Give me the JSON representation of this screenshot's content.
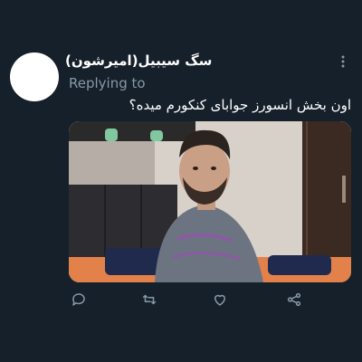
{
  "tweet": {
    "author_name": "سگ سیبیل(امیرشون)",
    "replying_label": "Replying to",
    "text": "اون بخش انسورز جوابای کنکورم میده؟"
  },
  "colors": {
    "background": "#15202b",
    "primary_text": "#ffffff",
    "secondary_text": "#8899a6",
    "icon": "#8899a6"
  },
  "icons": {
    "more": "more-vertical-icon",
    "reply": "comment-icon",
    "retweet": "retweet-icon",
    "like": "heart-icon",
    "share": "share-icon"
  }
}
